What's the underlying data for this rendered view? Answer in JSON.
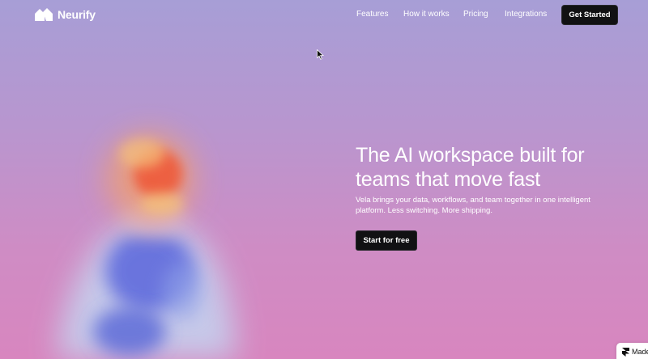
{
  "brand": {
    "name": "Neurify",
    "logo_icon": "neurify-logo-icon"
  },
  "nav": {
    "links": [
      "Features",
      "How it works",
      "Pricing",
      "Integrations"
    ],
    "cta_label": "Get Started"
  },
  "hero": {
    "title": "The AI workspace built for teams that move fast",
    "subtitle": "Vela brings your data, workflows, and team together in one intelligent platform. Less switching. More shipping.",
    "button_label": "Start for free"
  },
  "badge": {
    "label": "Made",
    "icon": "framer-icon"
  },
  "colors": {
    "background_top": "#a79ed6",
    "background_bottom": "#d886bf",
    "button_bg": "#111113",
    "figure_head": "#ef6a3c",
    "figure_body": "#5868d8"
  }
}
